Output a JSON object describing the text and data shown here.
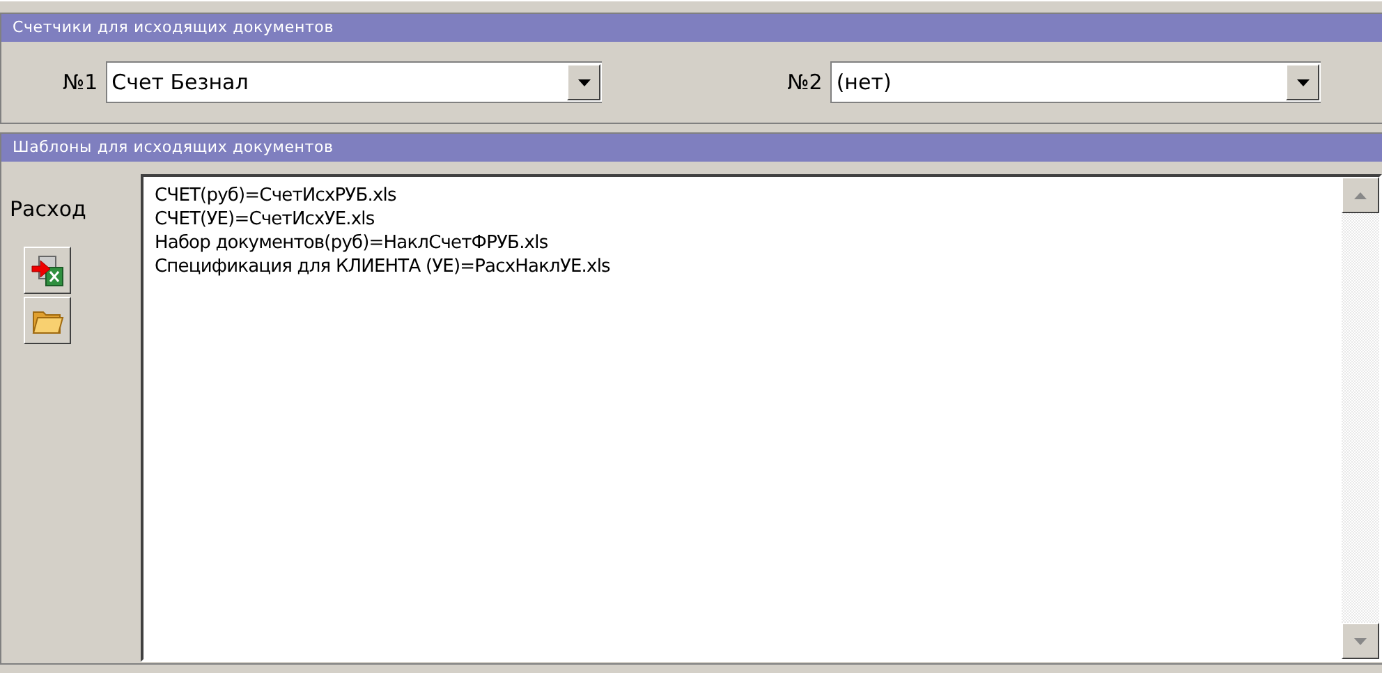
{
  "counters": {
    "title": "Счетчики для исходящих документов",
    "fields": [
      {
        "label": "№1",
        "value": "Счет Безнал"
      },
      {
        "label": "№2",
        "value": "(нет)"
      }
    ]
  },
  "templates": {
    "title": "Шаблоны для исходящих документов",
    "label": "Расход",
    "lines": [
      "СЧЕТ(руб)=СчетИсхРУБ.xls",
      "СЧЕТ(УЕ)=СчетИсхУЕ.xls",
      "Набор документов(руб)=НаклСчетФРУБ.xls",
      "Спецификация для КЛИЕНТА (УЕ)=РасхНаклУЕ.xls"
    ]
  }
}
